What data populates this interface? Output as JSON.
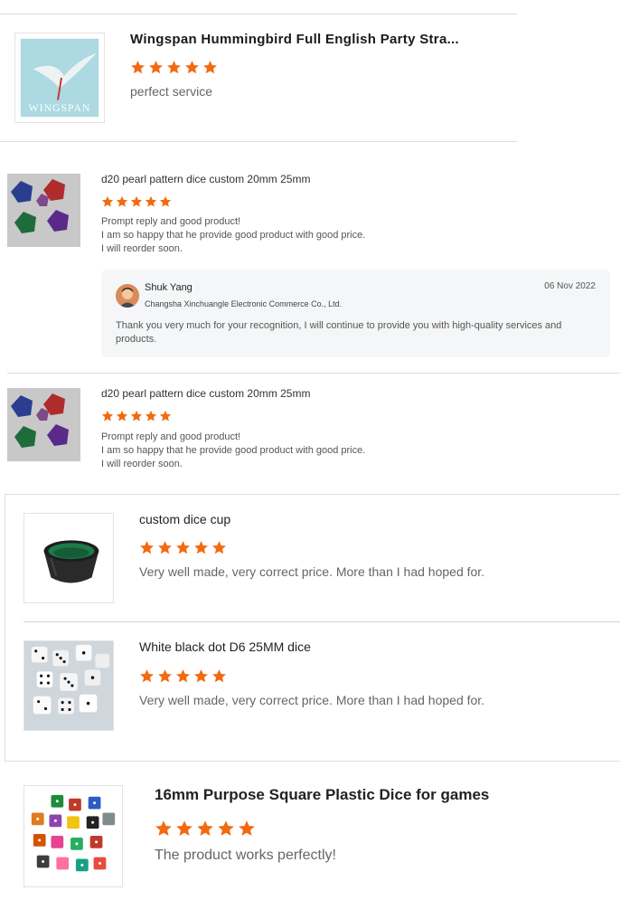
{
  "reviews": [
    {
      "title": "Wingspan Hummingbird Full English Party Stra...",
      "stars": 5,
      "text": "perfect service",
      "image_label": "WINGSPAN"
    },
    {
      "title": "d20 pearl pattern dice custom 20mm 25mm",
      "stars": 5,
      "lines": [
        "Prompt reply and good product!",
        "I am so happy that he provide good product with good price.",
        "I will reorder soon."
      ],
      "reply": {
        "name": "Shuk Yang",
        "company": "Changsha Xinchuangle Electronic Commerce Co., Ltd.",
        "date": "06 Nov 2022",
        "text": "Thank you very much for your recognition, I will continue to provide you with high-quality services and products."
      }
    },
    {
      "title": "d20 pearl pattern dice custom 20mm 25mm",
      "stars": 5,
      "lines": [
        "Prompt reply and good product!",
        "I am so happy that he provide good product with good price.",
        "I will reorder soon."
      ]
    },
    {
      "title": "custom dice cup",
      "stars": 5,
      "text": "Very well made, very correct  price. More than I had hoped for."
    },
    {
      "title": "White black dot D6 25MM dice",
      "stars": 5,
      "text": "Very well made, very correct  price. More than I had hoped for."
    },
    {
      "title": "16mm Purpose Square Plastic Dice for games",
      "stars": 5,
      "text": "The product works perfectly!"
    }
  ],
  "colors": {
    "star": "#f26a10",
    "divider": "#dcdcdc",
    "reply_bg": "#f5f6f7"
  },
  "icons": [
    "star-icon",
    "avatar"
  ]
}
